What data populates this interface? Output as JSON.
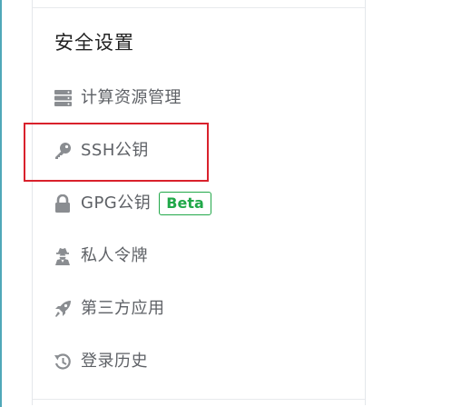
{
  "section": {
    "title": "安全设置"
  },
  "menu": {
    "items": [
      {
        "icon": "server-icon",
        "label": "计算资源管理"
      },
      {
        "icon": "key-icon",
        "label": "SSH公钥"
      },
      {
        "icon": "lock-icon",
        "label": "GPG公钥",
        "badge": "Beta"
      },
      {
        "icon": "user-secret-icon",
        "label": "私人令牌"
      },
      {
        "icon": "rocket-icon",
        "label": "第三方应用"
      },
      {
        "icon": "history-icon",
        "label": "登录历史"
      }
    ]
  },
  "colors": {
    "icon_gray": "#8a8d91",
    "text_gray": "#5e6166",
    "badge_green": "#21a849",
    "highlight_red": "#d9212c"
  }
}
